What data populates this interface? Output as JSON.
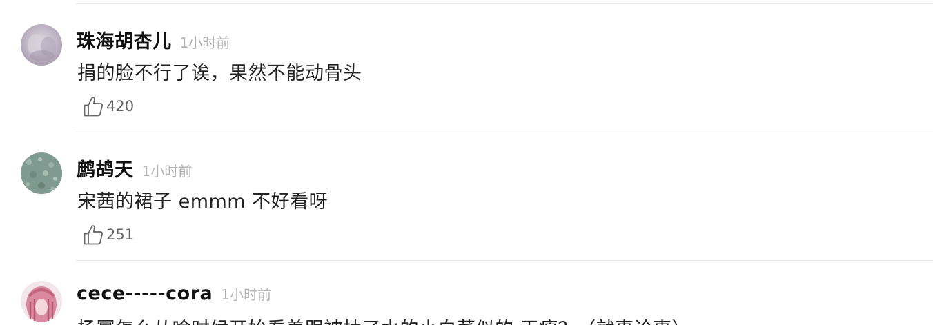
{
  "comments": [
    {
      "username": "珠海胡杏儿",
      "time": "1小时前",
      "content": "捐的脸不行了诶，果然不能动骨头",
      "likes": "420",
      "avatar_icon": "user-avatar",
      "avatar_color": "#c9bfcf"
    },
    {
      "username": "鹧鸪天",
      "time": "1小时前",
      "content": "宋茜的裙子 emmm 不好看呀",
      "likes": "251",
      "avatar_icon": "user-avatar",
      "avatar_color": "#7f9a90"
    },
    {
      "username": "cece-----cora",
      "time": "1小时前",
      "content": "杨幂怎么从啥时候开始看着跟被抽了水的小白菜似的 干瘪？（就事论事）",
      "likes": "",
      "avatar_icon": "user-avatar",
      "avatar_color": "#d98aa0"
    }
  ],
  "icons": {
    "like": "thumbs-up-outline-icon"
  }
}
